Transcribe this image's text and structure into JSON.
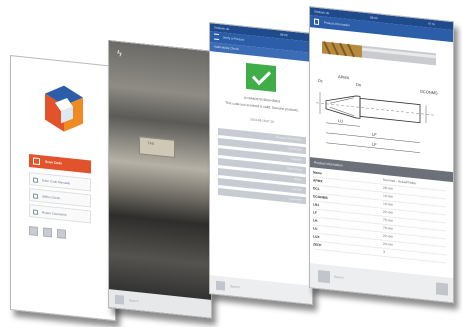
{
  "phone1": {
    "scan_label": "Scan Code",
    "menu": [
      "Enter Code Manually",
      "Offline Check",
      "Report Counterfeit"
    ]
  },
  "phone2": {
    "tag_text": "TAG",
    "search_placeholder": "Search"
  },
  "phone3": {
    "status_left": "Telekom.de",
    "status_right": "09:03",
    "header_title": "Verify a Product",
    "sub_title": "Authenticity Check",
    "code_text": "1F19A8CB7D25E0A4B9C6",
    "message": "This code you scanned is valid. Genuine products.",
    "date": "2014-03-18 07:15",
    "buttons": [
      "Product information",
      "Certificate",
      "Register",
      "Open Docs",
      "Share",
      "Contact",
      "Overview"
    ],
    "bottom_placeholder": "Search"
  },
  "phone4": {
    "status_left": "Telekom.de",
    "status_center": "08:03",
    "status_right": "47 %",
    "header_title": "Product information",
    "section_title": "Product information",
    "table_headers": [
      "Name",
      "Nominal - Actual/Value"
    ],
    "rows": [
      {
        "name": "APMX",
        "value": "28 mm"
      },
      {
        "name": "DCL",
        "value": "10 mm"
      },
      {
        "name": "DCONMS",
        "value": "10 mm"
      },
      {
        "name": "LB1",
        "value": "22 mm"
      },
      {
        "name": "LF",
        "value": "75 mm"
      },
      {
        "name": "LH",
        "value": "70 mm"
      },
      {
        "name": "LU",
        "value": "22 mm"
      },
      {
        "name": "LUX",
        "value": "24 mm"
      },
      {
        "name": "ZEFP",
        "value": "3"
      }
    ],
    "bottom_placeholder": "Search",
    "drawing_labels": [
      "Dc",
      "APMX",
      "Dn",
      "DCONMS",
      "LU",
      "LF",
      "LF"
    ]
  },
  "colors": {
    "blue": "#2b5da8",
    "accent_red": "#e2522b",
    "check_green": "#3fae49",
    "logo_orange": "#f08a24"
  }
}
